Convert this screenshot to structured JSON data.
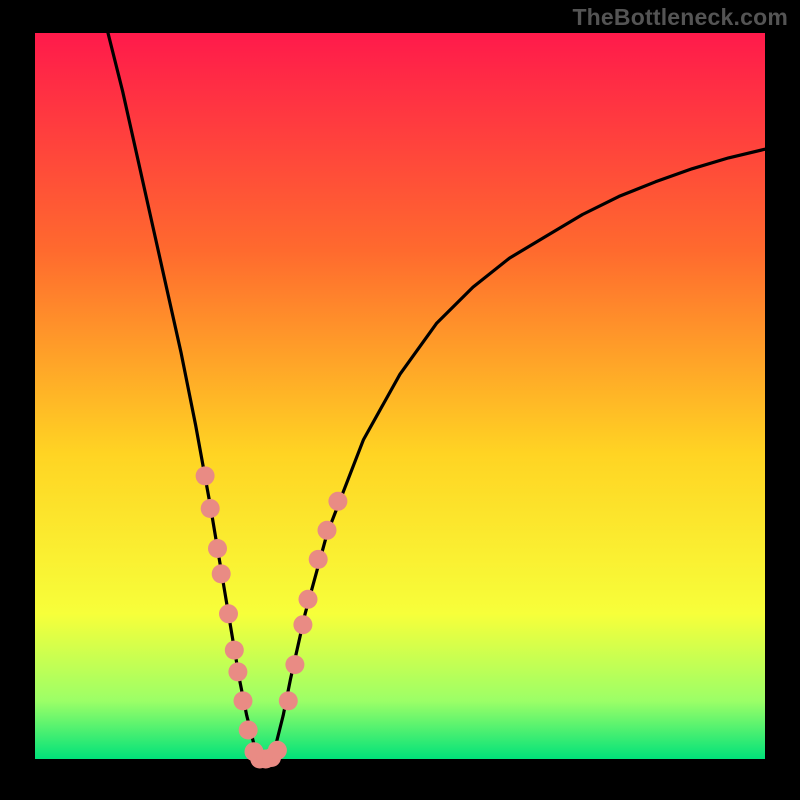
{
  "watermark": "TheBottleneck.com",
  "colors": {
    "frame": "#000000",
    "gradient_top": "#ff1a4b",
    "gradient_mid1": "#ff6a2e",
    "gradient_mid2": "#ffd423",
    "gradient_mid3": "#f7ff3a",
    "gradient_low": "#9cff67",
    "gradient_bottom": "#00e27a",
    "curve": "#000000",
    "marker": "#e98b84"
  },
  "chart_data": {
    "type": "line",
    "title": "",
    "xlabel": "",
    "ylabel": "",
    "xlim": [
      0,
      100
    ],
    "ylim": [
      0,
      100
    ],
    "annotations": [],
    "series": [
      {
        "name": "bottleneck-curve",
        "x": [
          10,
          12,
          14,
          16,
          18,
          20,
          22,
          24,
          25,
          26,
          27,
          28,
          29,
          30,
          31,
          32,
          33,
          34,
          35,
          37,
          40,
          45,
          50,
          55,
          60,
          65,
          70,
          75,
          80,
          85,
          90,
          95,
          100
        ],
        "y": [
          100,
          92,
          83,
          74,
          65,
          56,
          46,
          35,
          29,
          23,
          17,
          11,
          6,
          2,
          0,
          0,
          2,
          6,
          11,
          20,
          31,
          44,
          53,
          60,
          65,
          69,
          72,
          75,
          77.5,
          79.5,
          81.3,
          82.8,
          84
        ]
      }
    ],
    "markers": {
      "name": "highlight-dots",
      "points": [
        {
          "x": 23.3,
          "y": 39.0
        },
        {
          "x": 24.0,
          "y": 34.5
        },
        {
          "x": 25.0,
          "y": 29.0
        },
        {
          "x": 25.5,
          "y": 25.5
        },
        {
          "x": 26.5,
          "y": 20.0
        },
        {
          "x": 27.3,
          "y": 15.0
        },
        {
          "x": 27.8,
          "y": 12.0
        },
        {
          "x": 28.5,
          "y": 8.0
        },
        {
          "x": 29.2,
          "y": 4.0
        },
        {
          "x": 30.0,
          "y": 1.0
        },
        {
          "x": 30.8,
          "y": 0.0
        },
        {
          "x": 31.6,
          "y": 0.0
        },
        {
          "x": 32.4,
          "y": 0.2
        },
        {
          "x": 33.2,
          "y": 1.2
        },
        {
          "x": 34.7,
          "y": 8.0
        },
        {
          "x": 35.6,
          "y": 13.0
        },
        {
          "x": 36.7,
          "y": 18.5
        },
        {
          "x": 37.4,
          "y": 22.0
        },
        {
          "x": 38.8,
          "y": 27.5
        },
        {
          "x": 40.0,
          "y": 31.5
        },
        {
          "x": 41.5,
          "y": 35.5
        }
      ]
    }
  }
}
